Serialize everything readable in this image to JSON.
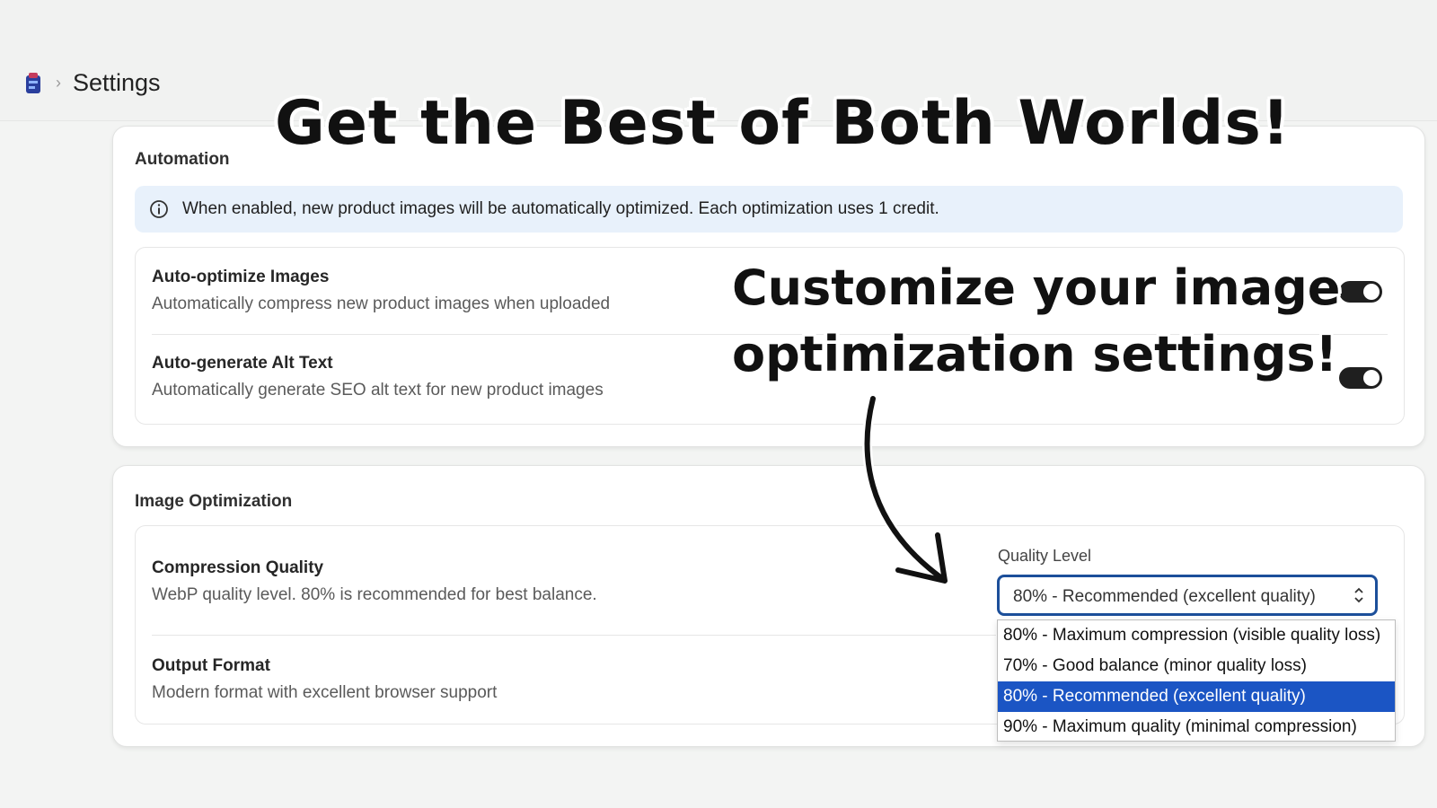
{
  "breadcrumb": {
    "separator": "›",
    "current": "Settings"
  },
  "automation": {
    "title": "Automation",
    "info_text": "When enabled, new product images will be automatically optimized. Each optimization uses 1 credit.",
    "settings": [
      {
        "title": "Auto-optimize Images",
        "description": "Automatically compress new product images when uploaded",
        "enabled": true
      },
      {
        "title": "Auto-generate Alt Text",
        "description": "Automatically generate SEO alt text for new product images",
        "enabled": true
      }
    ]
  },
  "image_optimization": {
    "title": "Image Optimization",
    "compression": {
      "title": "Compression Quality",
      "description": "WebP quality level. 80% is recommended for best balance."
    },
    "output_format": {
      "title": "Output Format",
      "description": "Modern format with excellent browser support"
    },
    "quality_select": {
      "label": "Quality Level",
      "value": "80% - Recommended (excellent quality)",
      "options": [
        "80% - Maximum compression (visible quality loss)",
        "70% - Good balance (minor quality loss)",
        "80% - Recommended (excellent quality)",
        "90% - Maximum quality (minimal compression)"
      ],
      "selected_index": 2
    }
  },
  "overlay": {
    "headline": "Get the Best of Both Worlds!",
    "callout_line1": "Customize your image",
    "callout_line2": "optimization settings!"
  },
  "colors": {
    "accent": "#1b55c4",
    "focus_border": "#1c4f9a",
    "info_banner": "#e8f1fb",
    "toggle_on": "#1f1f1f"
  },
  "icons": {
    "app_logo": "app-logo-icon",
    "info": "info-icon",
    "select_chevron": "chevron-up-down-icon",
    "callout_arrow": "curved-arrow-icon"
  }
}
